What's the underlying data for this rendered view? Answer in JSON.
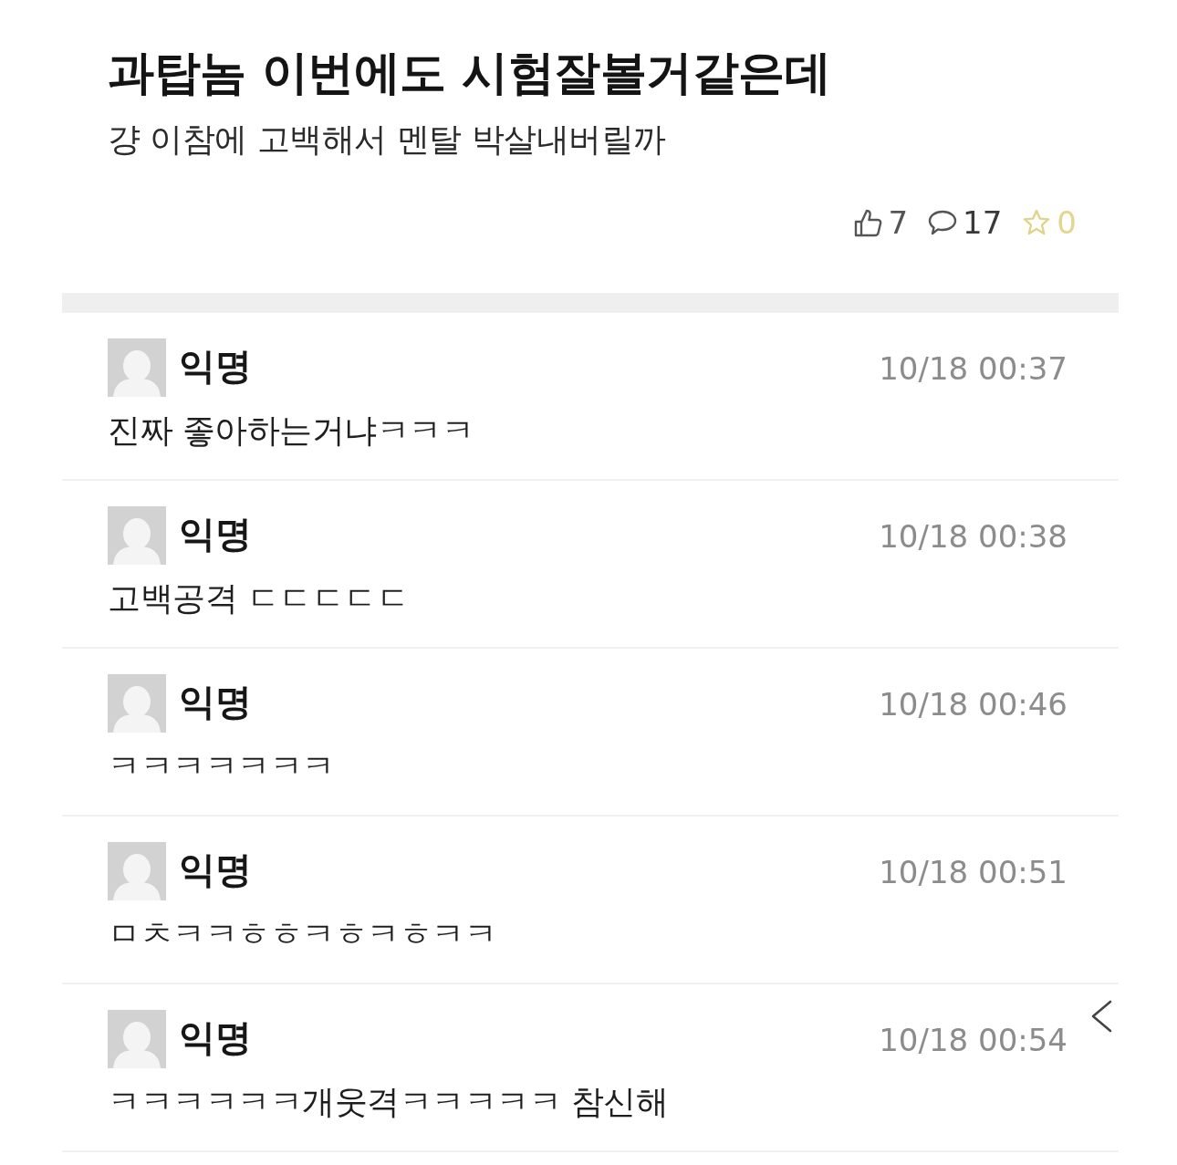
{
  "post": {
    "title": "과탑놈 이번에도 시험잘볼거같은데",
    "body": "걍 이참에 고백해서 멘탈 박살내버릴까",
    "stats": [
      {
        "kind": "like",
        "count": "7"
      },
      {
        "kind": "comment",
        "count": "17"
      },
      {
        "kind": "scrap",
        "count": "0"
      }
    ]
  },
  "comments": [
    {
      "author": "익명",
      "time": "10/18 00:37",
      "text": "진짜 좋아하는거냐ㅋㅋㅋ"
    },
    {
      "author": "익명",
      "time": "10/18 00:38",
      "text": "고백공격 ㄷㄷㄷㄷㄷ"
    },
    {
      "author": "익명",
      "time": "10/18 00:46",
      "text": "ㅋㅋㅋㅋㅋㅋㅋ"
    },
    {
      "author": "익명",
      "time": "10/18 00:51",
      "text": "ㅁㅊㅋㅋㅎㅎㅋㅎㅋㅎㅋㅋ"
    },
    {
      "author": "익명",
      "time": "10/18 00:54",
      "text": "ㅋㅋㅋㅋㅋㅋ개웃격ㅋㅋㅋㅋㅋ 참신해"
    }
  ]
}
